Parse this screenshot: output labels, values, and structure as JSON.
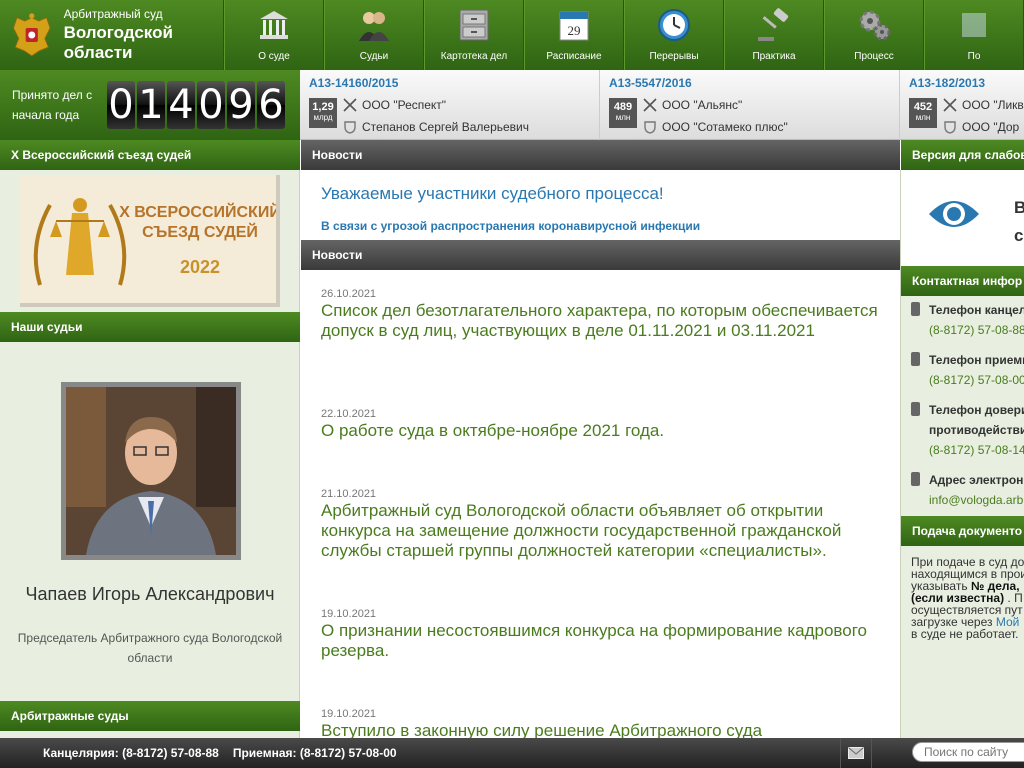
{
  "header": {
    "org_line1": "Арбитражный суд",
    "org_line2": "Вологодской области",
    "nav": [
      {
        "label": "О суде",
        "icon": "building-icon"
      },
      {
        "label": "Судьи",
        "icon": "judges-icon"
      },
      {
        "label": "Картотека дел",
        "icon": "cabinet-icon"
      },
      {
        "label": "Расписание",
        "icon": "calendar-icon"
      },
      {
        "label": "Перерывы",
        "icon": "clock-icon"
      },
      {
        "label": "Практика",
        "icon": "gavel-icon"
      },
      {
        "label": "Процесс",
        "icon": "gears-icon"
      },
      {
        "label": "По",
        "icon": "next-icon"
      }
    ],
    "calendar_day": "29"
  },
  "counter": {
    "label": "Принято дел с начала года",
    "digits": [
      "0",
      "1",
      "4",
      "0",
      "9",
      "6"
    ]
  },
  "cases": [
    {
      "number": "А13-14160/2015",
      "amount": "1,29",
      "unit": "млрд",
      "plaintiff": "ООО \"Респект\"",
      "defendant": "Степанов Сергей Валерьевич"
    },
    {
      "number": "А13-5547/2016",
      "amount": "489",
      "unit": "млн",
      "plaintiff": "ООО \"Альянс\"",
      "defendant": "ООО \"Сотамеко плюс\""
    },
    {
      "number": "А13-182/2013",
      "amount": "452",
      "unit": "млн",
      "plaintiff": "ООО \"Ликв",
      "defendant": "ООО \"Дор"
    }
  ],
  "left": {
    "congress_header": "Х Всероссийский съезд судей",
    "banner": {
      "line1": "Х ВСЕРОССИЙСКИЙ",
      "line2": "СЪЕЗД СУДЕЙ",
      "year": "2022"
    },
    "judges_header": "Наши судьи",
    "judge_name": "Чапаев Игорь Александрович",
    "judge_position": "Председатель Арбитражного суда Вологодской области",
    "courts_header": "Арбитражные суды"
  },
  "center": {
    "news_header1": "Новости",
    "notice_title": "Уважаемые участники судебного процесса!",
    "notice_sub": "В связи с угрозой распространения коронавирусной инфекции",
    "news_header2": "Новости",
    "news": [
      {
        "date": "26.10.2021",
        "title": "Список дел безотлагательного характера, по которым обеспечивается допуск в суд лиц, участвующих в деле 01.11.2021 и 03.11.2021"
      },
      {
        "date": "22.10.2021",
        "title": "О работе суда в октябре-ноябре 2021 года."
      },
      {
        "date": "21.10.2021",
        "title": "Арбитражный суд Вологодской области объявляет об открытии конкурса на замещение должности государственной гражданской службы старшей группы должностей категории «специалисты»."
      },
      {
        "date": "19.10.2021",
        "title": "О признании несостоявшимся конкурса на формирование кадрового резерва."
      },
      {
        "date": "19.10.2021",
        "title": "Вступило в законную силу решение Арбитражного суда"
      }
    ]
  },
  "right": {
    "vision_header": "Версия для слабов",
    "vision_text_l1": "В",
    "vision_text_l2": "с",
    "contact_header": "Контактная инфор",
    "contacts": [
      {
        "label": "Телефон канцел",
        "value": "(8-8172) 57-08-88"
      },
      {
        "label": "Телефон приемн",
        "value": "(8-8172) 57-08-00"
      },
      {
        "label": "Телефон довери",
        "label2": "противодействи",
        "value": "(8-8172) 57-08-14"
      },
      {
        "label": "Адрес электрон",
        "value": "info@vologda.arb"
      }
    ],
    "filing_header": "Подача документо",
    "filing": {
      "l1": "При подаче в суд до",
      "l2": "находящимся в прои",
      "l3a": "указывать ",
      "l3b": "№ дела,",
      "l4": "(если известна)",
      "l4b": " . П",
      "l5": "осуществляется пут",
      "l6a": "загрузке через ",
      "l6b": "Мой",
      "l7": "в суде не работает."
    }
  },
  "footer": {
    "office": "Канцелярия: (8-8172) 57-08-88",
    "reception": "Приемная: (8-8172) 57-08-00",
    "search_placeholder": "Поиск по сайту"
  }
}
